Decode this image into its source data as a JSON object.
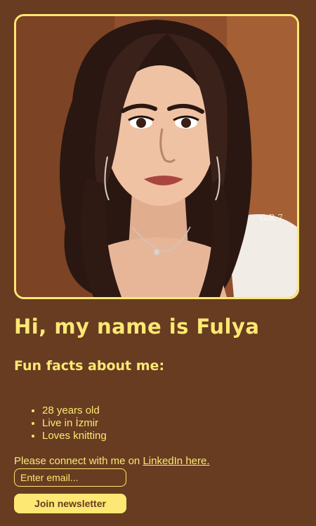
{
  "profile": {
    "photo_alt": "Portrait illustration of Fulya",
    "watermark": "G.R.7"
  },
  "heading": "Hi, my name is Fulya",
  "subheading": "Fun facts about me:",
  "facts": [
    "28 years old",
    "Live in İzmir",
    "Loves knitting"
  ],
  "connect": {
    "text": "Please connect with me on ",
    "link_label": "LinkedIn here."
  },
  "newsletter": {
    "email_placeholder": "Enter email...",
    "button_label": "Join newsletter"
  },
  "colors": {
    "background": "#673c21",
    "accent": "#fde873"
  }
}
